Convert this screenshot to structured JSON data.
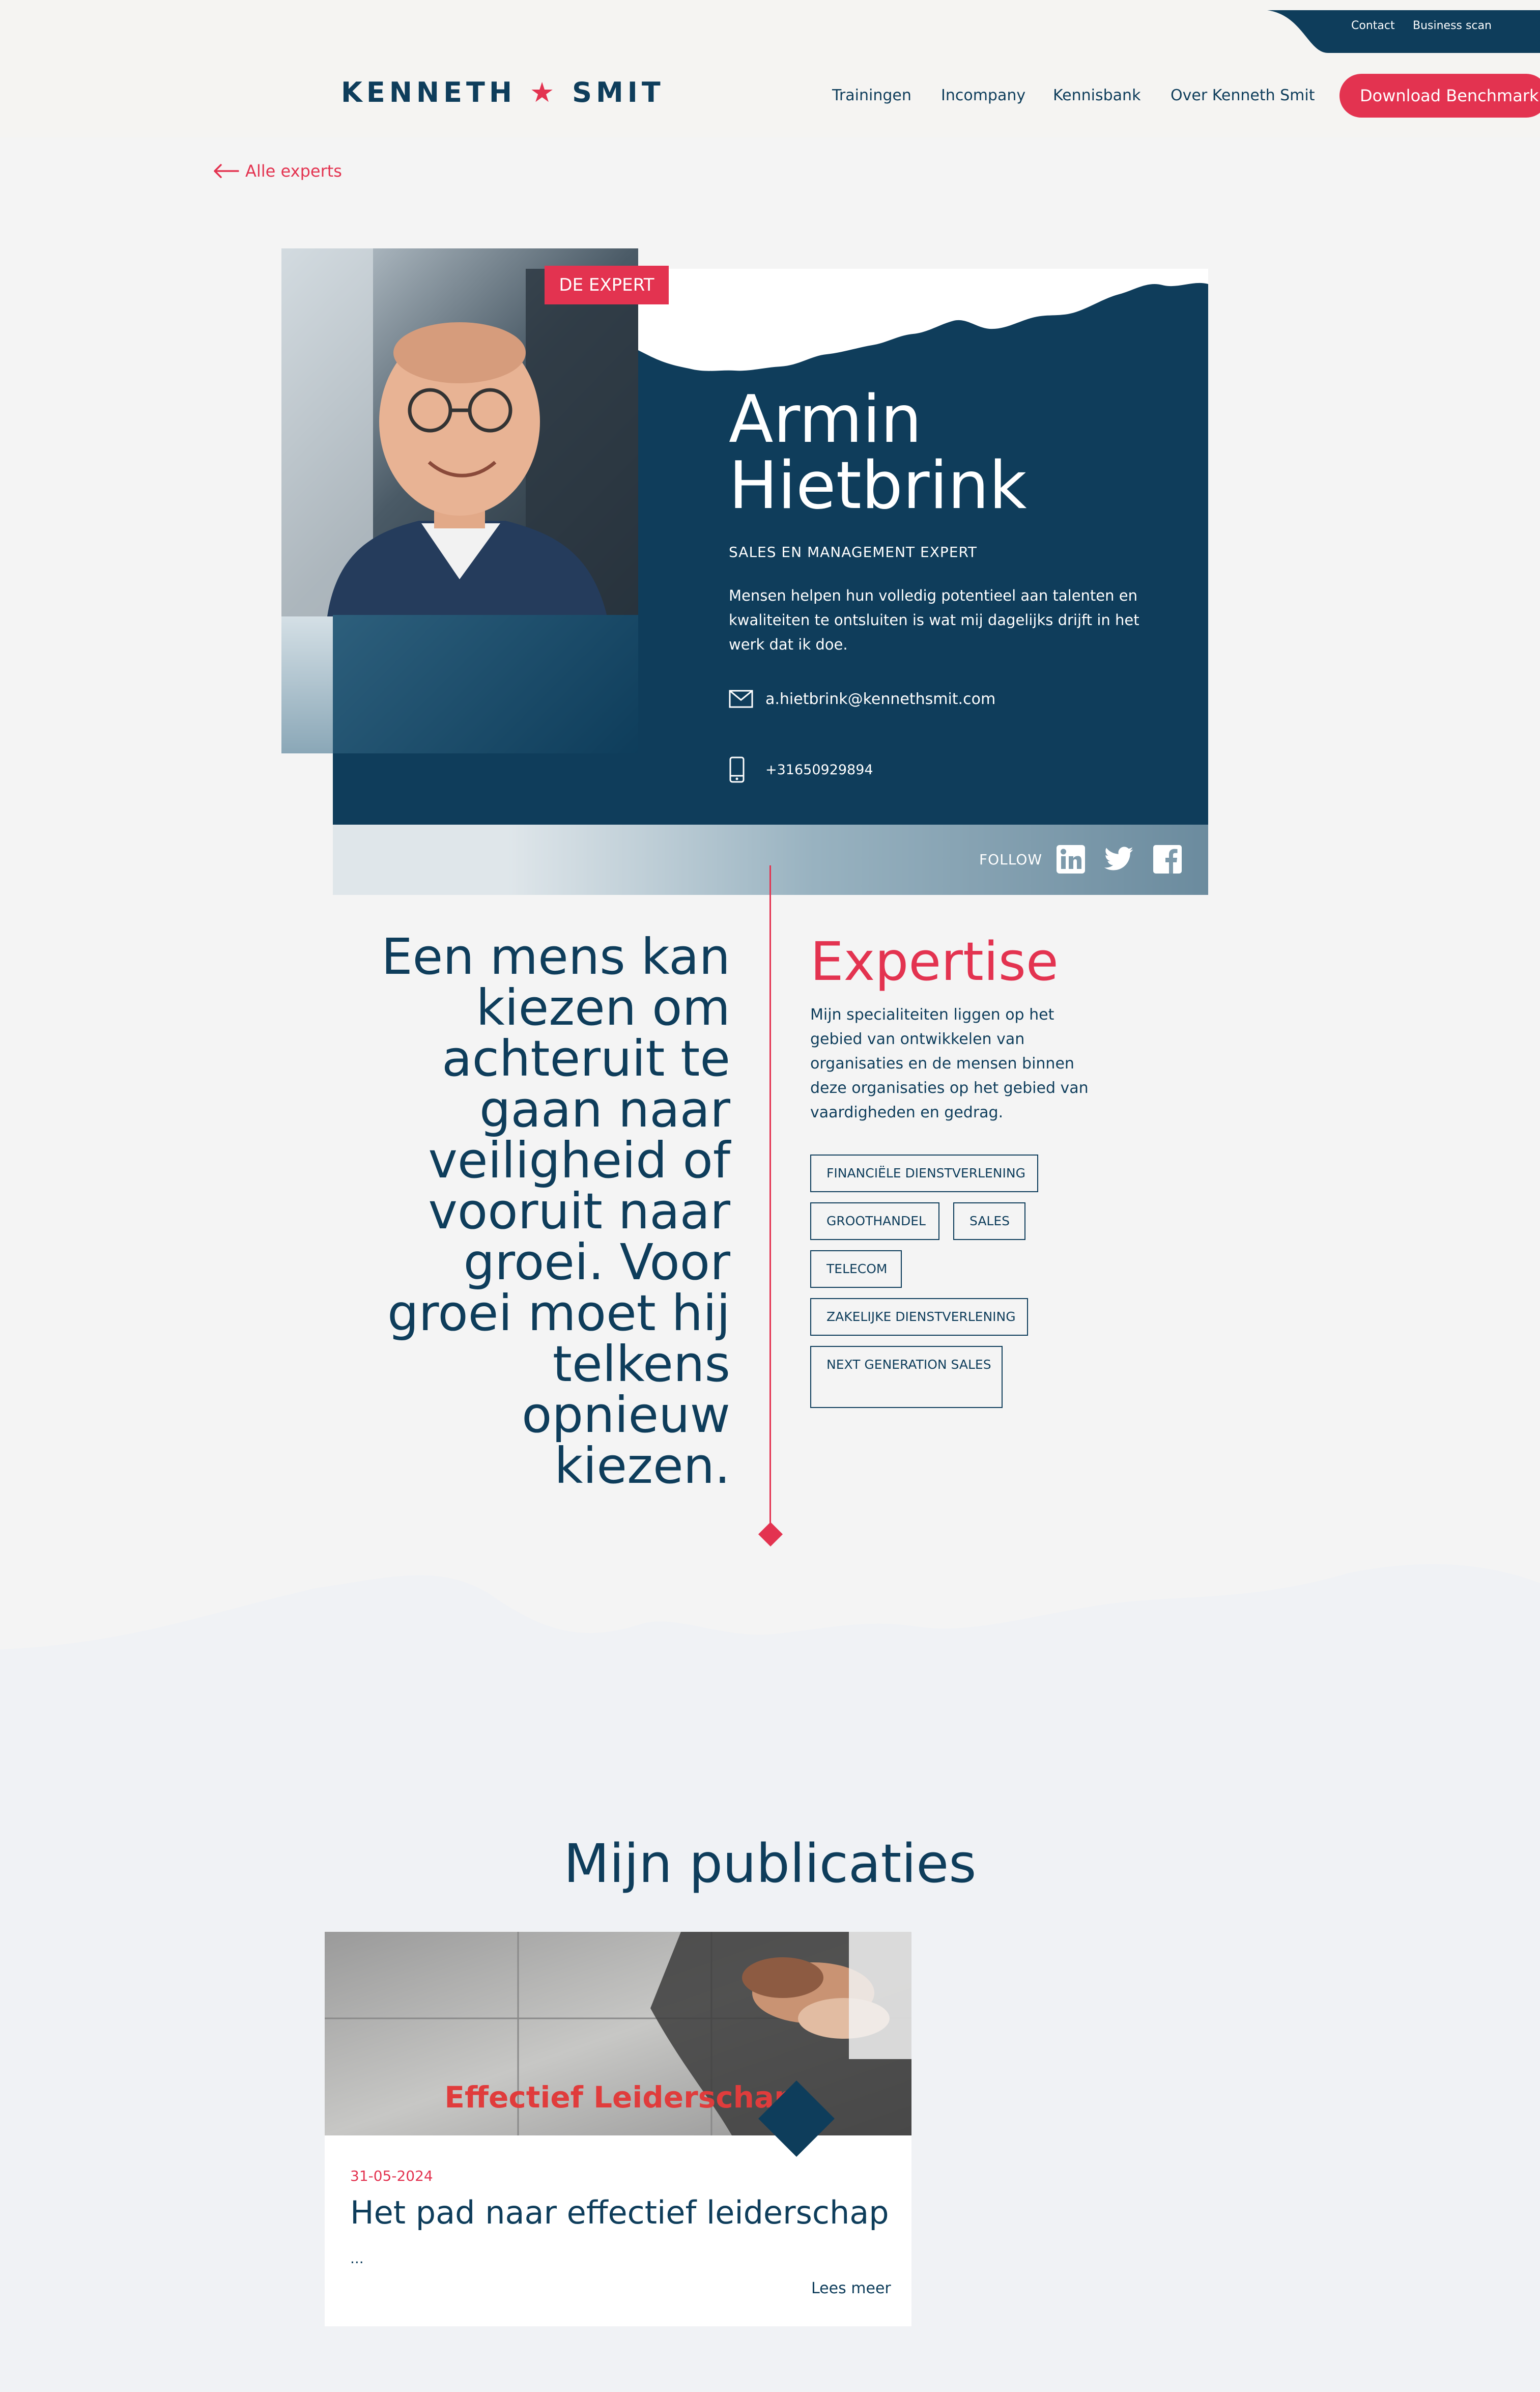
{
  "header": {
    "top_links": [
      "Contact",
      "Business scan"
    ],
    "logo": {
      "left": "KENNETH",
      "star": "★",
      "right": "SMIT"
    },
    "nav": [
      "Trainingen",
      "Incompany",
      "Kennisbank",
      "Over Kenneth Smit"
    ],
    "cta": "Download Benchmark"
  },
  "back_link": "Alle experts",
  "profile": {
    "badge": "DE EXPERT",
    "first_name": "Armin",
    "last_name": "Hietbrink",
    "role": "SALES EN MANAGEMENT EXPERT",
    "intro": "Mensen helpen hun volledig potentieel aan talenten en kwaliteiten te ontsluiten is wat mij dagelijks drijft in het werk dat ik doe.",
    "email": "a.hietbrink@kennethsmit.com",
    "phone": "+31650929894",
    "follow_label": "FOLLOW",
    "socials": [
      "linkedin-icon",
      "twitter-icon",
      "facebook-icon"
    ]
  },
  "quote": "Een mens kan kiezen om achteruit te gaan naar veiligheid of vooruit naar groei. Voor groei moet hij telkens opnieuw kiezen.",
  "expertise": {
    "title": "Expertise",
    "text": "Mijn specialiteiten liggen op het gebied van ontwikkelen van organisaties en de mensen binnen deze organisaties op het gebied van vaardigheden en gedrag.",
    "tags": [
      "FINANCIËLE DIENSTVERLENING",
      "GROOTHANDEL",
      "SALES",
      "TELECOM",
      "ZAKELIJKE DIENSTVERLENING",
      "NEXT GENERATION SALES"
    ]
  },
  "publications": {
    "title": "Mijn publicaties",
    "items": [
      {
        "image_caption": "Effectief Leiderschap",
        "date": "31-05-2024",
        "title": "Het pad naar effectief leiderschap",
        "excerpt": "...",
        "more": "Lees meer"
      }
    ]
  },
  "colors": {
    "navy": "#0e3d5b",
    "red": "#e33350",
    "background": "#f4f4f4"
  }
}
